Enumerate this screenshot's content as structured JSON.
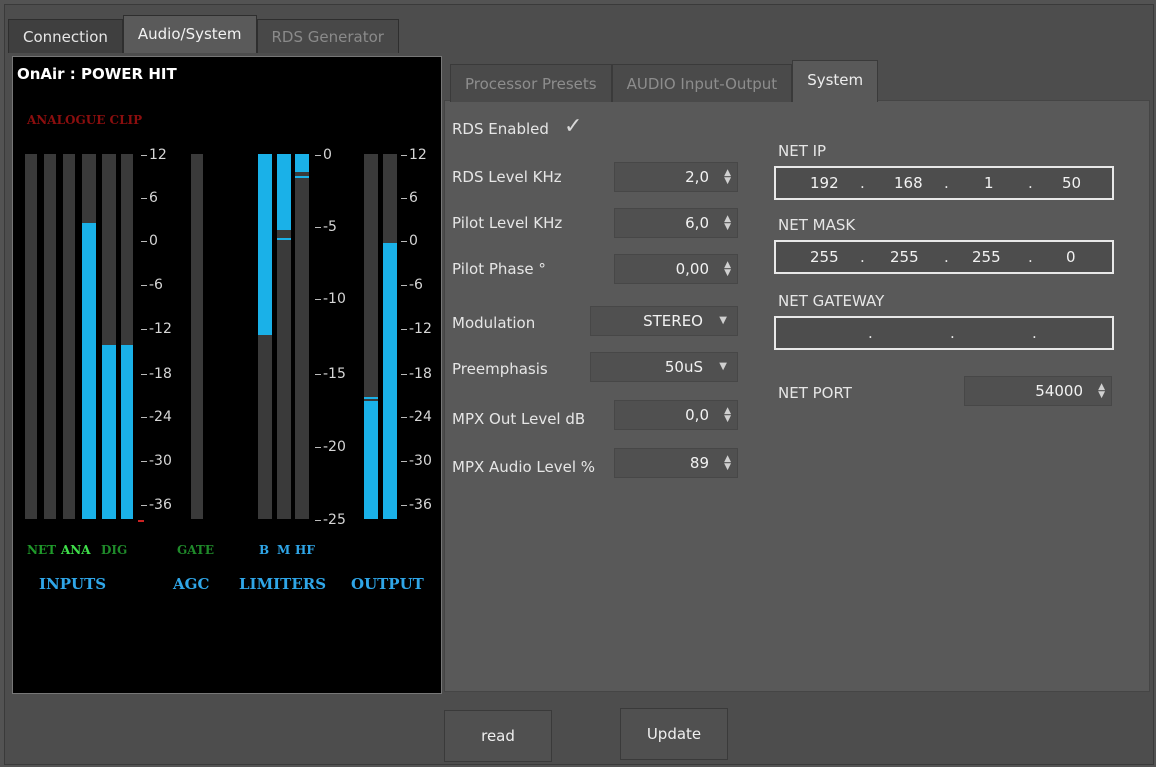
{
  "tabs": [
    "Connection",
    "Audio/System",
    "RDS Generator"
  ],
  "meter": {
    "onair": "OnAir : POWER HIT",
    "clip": "ANALOGUE CLIP",
    "scale_db": [
      "12",
      "6",
      "0",
      "-6",
      "-12",
      "-18",
      "-24",
      "-30",
      "-36"
    ],
    "scale_limiter": [
      "0",
      "-5",
      "-10",
      "-15",
      "-20",
      "-25"
    ],
    "input_labels": [
      "NET",
      "ANA",
      "DIG"
    ],
    "gate_label": "GATE",
    "band_labels": [
      "B",
      "M",
      "HF"
    ],
    "sections": [
      "INPUTS",
      "AGC",
      "LIMITERS",
      "OUTPUT"
    ],
    "colors": {
      "bar_fill": "#1ab1e8",
      "net": "#1f9a2a",
      "ana": "#3fe04a",
      "dig": "#1f8a2a",
      "gate": "#1f8a2a",
      "bands": "#2fa6e8",
      "clip": "#8b0e0e"
    }
  },
  "subtabs": [
    "Processor Presets",
    "AUDIO Input-Output",
    "System"
  ],
  "system": {
    "rds_enabled": {
      "label": "RDS Enabled",
      "checked": true
    },
    "rds_level": {
      "label": "RDS Level KHz",
      "value": "2,0"
    },
    "pilot_level": {
      "label": "Pilot Level KHz",
      "value": "6,0"
    },
    "pilot_phase": {
      "label": "Pilot Phase °",
      "value": "0,00"
    },
    "modulation": {
      "label": "Modulation",
      "value": "STEREO"
    },
    "preemphasis": {
      "label": "Preemphasis",
      "value": "50uS"
    },
    "mpx_out": {
      "label": "MPX Out Level dB",
      "value": "0,0"
    },
    "mpx_audio": {
      "label": "MPX Audio Level %",
      "value": "89"
    },
    "net_ip": {
      "label": "NET IP",
      "octets": [
        "192",
        "168",
        "1",
        "50"
      ]
    },
    "net_mask": {
      "label": "NET MASK",
      "octets": [
        "255",
        "255",
        "255",
        "0"
      ]
    },
    "net_gateway": {
      "label": "NET GATEWAY",
      "octets": [
        "",
        "",
        "",
        ""
      ]
    },
    "net_port": {
      "label": "NET PORT",
      "value": "54000"
    }
  },
  "buttons": {
    "read": "read",
    "update": "Update"
  }
}
